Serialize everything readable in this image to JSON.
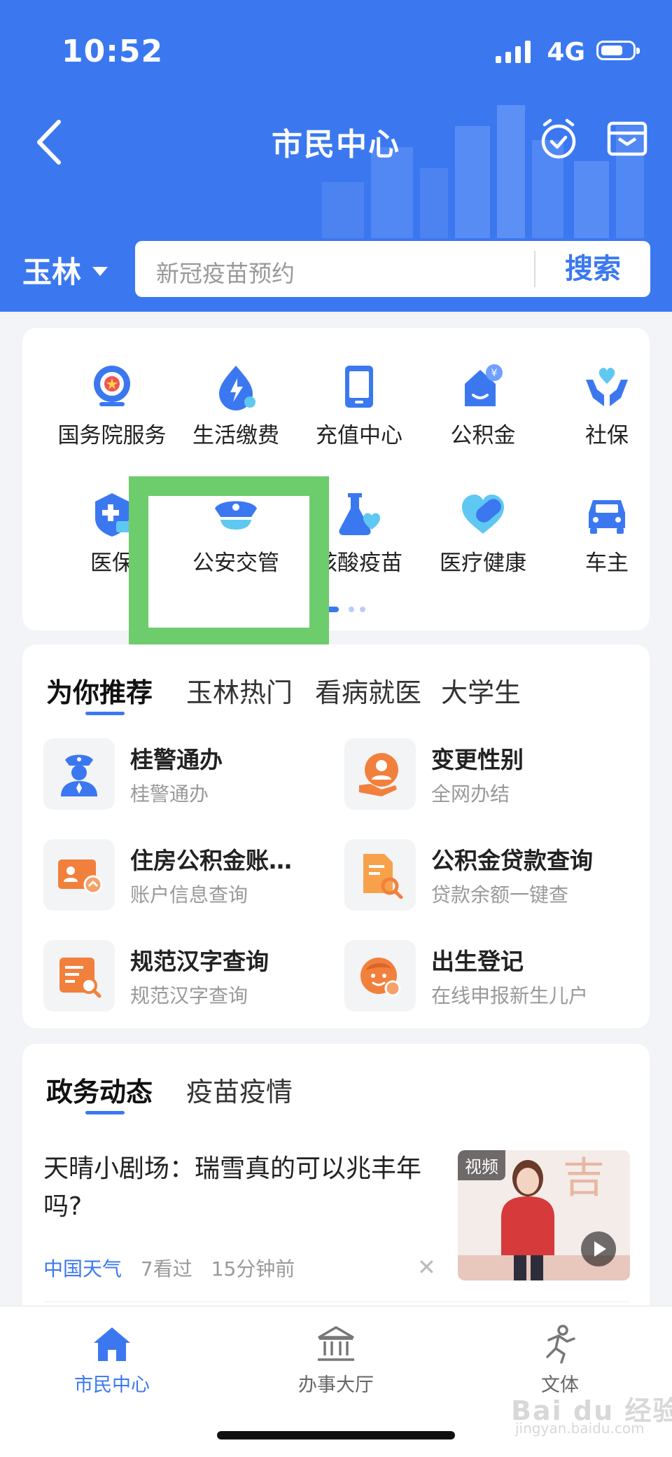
{
  "status_bar": {
    "time": "10:52",
    "network": "4G"
  },
  "nav": {
    "title": "市民中心"
  },
  "city_selector": {
    "city": "玉林"
  },
  "search": {
    "placeholder": "新冠疫苗预约",
    "button": "搜索"
  },
  "services": [
    {
      "label": "国务院服务",
      "icon": "state-council-icon"
    },
    {
      "label": "生活缴费",
      "icon": "utility-bill-icon"
    },
    {
      "label": "充值中心",
      "icon": "phone-recharge-icon"
    },
    {
      "label": "公积金",
      "icon": "housing-fund-icon"
    },
    {
      "label": "社保",
      "icon": "social-security-icon"
    },
    {
      "label": "医保",
      "icon": "medical-insurance-icon"
    },
    {
      "label": "公安交管",
      "icon": "police-cap-icon"
    },
    {
      "label": "核酸疫苗",
      "icon": "flask-heart-icon"
    },
    {
      "label": "医疗健康",
      "icon": "heart-pill-icon"
    },
    {
      "label": "车主",
      "icon": "car-icon"
    }
  ],
  "recommend": {
    "tabs": [
      "为你推荐",
      "玉林热门",
      "看病就医",
      "大学生"
    ],
    "active_tab": 0,
    "items": [
      {
        "title": "桂警通办",
        "subtitle": "桂警通办",
        "icon": "police-officer-icon"
      },
      {
        "title": "变更性别",
        "subtitle": "全网办结",
        "icon": "person-hand-icon"
      },
      {
        "title": "住房公积金账…",
        "subtitle": "账户信息查询",
        "icon": "account-card-icon"
      },
      {
        "title": "公积金贷款查询",
        "subtitle": "贷款余额一键查",
        "icon": "document-search-icon"
      },
      {
        "title": "规范汉字查询",
        "subtitle": "规范汉字查询",
        "icon": "text-search-icon"
      },
      {
        "title": "出生登记",
        "subtitle": "在线申报新生儿户",
        "icon": "baby-face-icon"
      }
    ]
  },
  "news": {
    "tabs": [
      "政务动态",
      "疫苗疫情"
    ],
    "active_tab": 0,
    "article": {
      "title": "天晴小剧场：瑞雪真的可以兆丰年吗?",
      "source": "中国天气",
      "views": "7看过",
      "time": "15分钟前",
      "thumb_tag": "视频"
    }
  },
  "tabbar": [
    {
      "label": "市民中心",
      "icon": "home-icon",
      "active": true
    },
    {
      "label": "办事大厅",
      "icon": "government-hall-icon",
      "active": false
    },
    {
      "label": "文体",
      "icon": "running-person-icon",
      "active": false
    }
  ],
  "watermark": {
    "text": "Bai du 经验",
    "sub": "jingyan.baidu.com"
  },
  "colors": {
    "primary": "#3b78f0",
    "orange": "#f2803d",
    "highlight": "#6dcc6c"
  }
}
